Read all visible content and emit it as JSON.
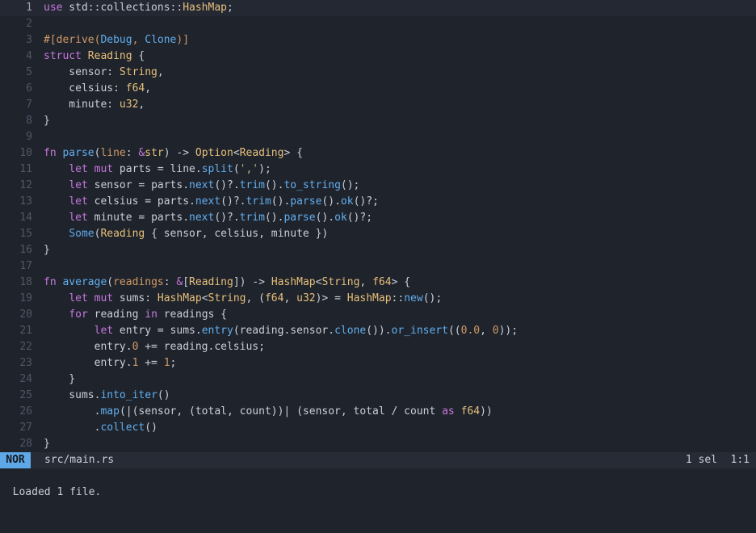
{
  "editor": {
    "lines": [
      {
        "n": "1",
        "cursor": true,
        "tokens": [
          [
            "kw",
            "use"
          ],
          [
            "txt",
            " std::collections::"
          ],
          [
            "ty",
            "HashMap"
          ],
          [
            "txt",
            ";"
          ]
        ]
      },
      {
        "n": "2",
        "tokens": []
      },
      {
        "n": "3",
        "tokens": [
          [
            "attr",
            "#[derive("
          ],
          [
            "fn",
            "Debug"
          ],
          [
            "attr",
            ", "
          ],
          [
            "fn",
            "Clone"
          ],
          [
            "attr",
            ")]"
          ]
        ]
      },
      {
        "n": "4",
        "tokens": [
          [
            "kw",
            "struct"
          ],
          [
            "txt",
            " "
          ],
          [
            "ty",
            "Reading"
          ],
          [
            "txt",
            " {"
          ]
        ]
      },
      {
        "n": "5",
        "tokens": [
          [
            "txt",
            "    sensor: "
          ],
          [
            "ty",
            "String"
          ],
          [
            "txt",
            ","
          ]
        ]
      },
      {
        "n": "6",
        "tokens": [
          [
            "txt",
            "    celsius: "
          ],
          [
            "ty",
            "f64"
          ],
          [
            "txt",
            ","
          ]
        ]
      },
      {
        "n": "7",
        "tokens": [
          [
            "txt",
            "    minute: "
          ],
          [
            "ty",
            "u32"
          ],
          [
            "txt",
            ","
          ]
        ]
      },
      {
        "n": "8",
        "tokens": [
          [
            "txt",
            "}"
          ]
        ]
      },
      {
        "n": "9",
        "tokens": []
      },
      {
        "n": "10",
        "tokens": [
          [
            "kw",
            "fn"
          ],
          [
            "txt",
            " "
          ],
          [
            "fn",
            "parse"
          ],
          [
            "txt",
            "("
          ],
          [
            "num",
            "line"
          ],
          [
            "txt",
            ": "
          ],
          [
            "kw",
            "&"
          ],
          [
            "ty",
            "str"
          ],
          [
            "txt",
            ") -> "
          ],
          [
            "ty",
            "Option"
          ],
          [
            "txt",
            "<"
          ],
          [
            "ty",
            "Reading"
          ],
          [
            "txt",
            "> {"
          ]
        ]
      },
      {
        "n": "11",
        "tokens": [
          [
            "txt",
            "    "
          ],
          [
            "kw",
            "let mut"
          ],
          [
            "txt",
            " parts = line."
          ],
          [
            "fn",
            "split"
          ],
          [
            "txt",
            "("
          ],
          [
            "str",
            "','"
          ],
          [
            "txt",
            ");"
          ]
        ]
      },
      {
        "n": "12",
        "tokens": [
          [
            "txt",
            "    "
          ],
          [
            "kw",
            "let"
          ],
          [
            "txt",
            " sensor = parts."
          ],
          [
            "fn",
            "next"
          ],
          [
            "txt",
            "()?."
          ],
          [
            "fn",
            "trim"
          ],
          [
            "txt",
            "()."
          ],
          [
            "fn",
            "to_string"
          ],
          [
            "txt",
            "();"
          ]
        ]
      },
      {
        "n": "13",
        "tokens": [
          [
            "txt",
            "    "
          ],
          [
            "kw",
            "let"
          ],
          [
            "txt",
            " celsius = parts."
          ],
          [
            "fn",
            "next"
          ],
          [
            "txt",
            "()?."
          ],
          [
            "fn",
            "trim"
          ],
          [
            "txt",
            "()."
          ],
          [
            "fn",
            "parse"
          ],
          [
            "txt",
            "()."
          ],
          [
            "fn",
            "ok"
          ],
          [
            "txt",
            "()?;"
          ]
        ]
      },
      {
        "n": "14",
        "tokens": [
          [
            "txt",
            "    "
          ],
          [
            "kw",
            "let"
          ],
          [
            "txt",
            " minute = parts."
          ],
          [
            "fn",
            "next"
          ],
          [
            "txt",
            "()?."
          ],
          [
            "fn",
            "trim"
          ],
          [
            "txt",
            "()."
          ],
          [
            "fn",
            "parse"
          ],
          [
            "txt",
            "()."
          ],
          [
            "fn",
            "ok"
          ],
          [
            "txt",
            "()?;"
          ]
        ]
      },
      {
        "n": "15",
        "tokens": [
          [
            "txt",
            "    "
          ],
          [
            "kw2",
            "Some"
          ],
          [
            "txt",
            "("
          ],
          [
            "ty",
            "Reading"
          ],
          [
            "txt",
            " { sensor, celsius, minute })"
          ]
        ]
      },
      {
        "n": "16",
        "tokens": [
          [
            "txt",
            "}"
          ]
        ]
      },
      {
        "n": "17",
        "tokens": []
      },
      {
        "n": "18",
        "tokens": [
          [
            "kw",
            "fn"
          ],
          [
            "txt",
            " "
          ],
          [
            "fn",
            "average"
          ],
          [
            "txt",
            "("
          ],
          [
            "num",
            "readings"
          ],
          [
            "txt",
            ": "
          ],
          [
            "kw",
            "&"
          ],
          [
            "txt",
            "["
          ],
          [
            "ty",
            "Reading"
          ],
          [
            "txt",
            "]) -> "
          ],
          [
            "ty",
            "HashMap"
          ],
          [
            "txt",
            "<"
          ],
          [
            "ty",
            "String"
          ],
          [
            "txt",
            ", "
          ],
          [
            "ty",
            "f64"
          ],
          [
            "txt",
            "> {"
          ]
        ]
      },
      {
        "n": "19",
        "tokens": [
          [
            "txt",
            "    "
          ],
          [
            "kw",
            "let mut"
          ],
          [
            "txt",
            " sums: "
          ],
          [
            "ty",
            "HashMap"
          ],
          [
            "txt",
            "<"
          ],
          [
            "ty",
            "String"
          ],
          [
            "txt",
            ", ("
          ],
          [
            "ty",
            "f64"
          ],
          [
            "txt",
            ", "
          ],
          [
            "ty",
            "u32"
          ],
          [
            "txt",
            ")> = "
          ],
          [
            "ty",
            "HashMap"
          ],
          [
            "txt",
            "::"
          ],
          [
            "fn",
            "new"
          ],
          [
            "txt",
            "();"
          ]
        ]
      },
      {
        "n": "20",
        "tokens": [
          [
            "txt",
            "    "
          ],
          [
            "kw",
            "for"
          ],
          [
            "txt",
            " reading "
          ],
          [
            "kw",
            "in"
          ],
          [
            "txt",
            " readings {"
          ]
        ]
      },
      {
        "n": "21",
        "tokens": [
          [
            "txt",
            "        "
          ],
          [
            "kw",
            "let"
          ],
          [
            "txt",
            " entry = sums."
          ],
          [
            "fn",
            "entry"
          ],
          [
            "txt",
            "(reading.sensor."
          ],
          [
            "fn",
            "clone"
          ],
          [
            "txt",
            "())."
          ],
          [
            "fn",
            "or_insert"
          ],
          [
            "txt",
            "(("
          ],
          [
            "num",
            "0.0"
          ],
          [
            "txt",
            ", "
          ],
          [
            "num",
            "0"
          ],
          [
            "txt",
            "));"
          ]
        ]
      },
      {
        "n": "22",
        "tokens": [
          [
            "txt",
            "        entry."
          ],
          [
            "num",
            "0"
          ],
          [
            "txt",
            " += reading.celsius;"
          ]
        ]
      },
      {
        "n": "23",
        "tokens": [
          [
            "txt",
            "        entry."
          ],
          [
            "num",
            "1"
          ],
          [
            "txt",
            " += "
          ],
          [
            "num",
            "1"
          ],
          [
            "txt",
            ";"
          ]
        ]
      },
      {
        "n": "24",
        "tokens": [
          [
            "txt",
            "    }"
          ]
        ]
      },
      {
        "n": "25",
        "tokens": [
          [
            "txt",
            "    sums."
          ],
          [
            "fn",
            "into_iter"
          ],
          [
            "txt",
            "()"
          ]
        ]
      },
      {
        "n": "26",
        "tokens": [
          [
            "txt",
            "        ."
          ],
          [
            "fn",
            "map"
          ],
          [
            "txt",
            "(|(sensor, (total, count))| (sensor, total / count "
          ],
          [
            "kw",
            "as"
          ],
          [
            "txt",
            " "
          ],
          [
            "ty",
            "f64"
          ],
          [
            "txt",
            "))"
          ]
        ]
      },
      {
        "n": "27",
        "tokens": [
          [
            "txt",
            "        ."
          ],
          [
            "fn",
            "collect"
          ],
          [
            "txt",
            "()"
          ]
        ]
      },
      {
        "n": "28",
        "tokens": [
          [
            "txt",
            "}"
          ]
        ]
      }
    ]
  },
  "statusline": {
    "mode": "NOR",
    "file": "src/main.rs",
    "selections": "1 sel",
    "position": "1:1"
  },
  "messageline": {
    "text": "Loaded 1 file."
  },
  "colors": {
    "background": "#1f232c",
    "statusline_bg": "#262b35",
    "mode_badge": "#5fa8e8",
    "keyword": "#c678dd",
    "type": "#e6c07b",
    "function": "#61afef",
    "number": "#d19a66",
    "string": "#98c379"
  }
}
